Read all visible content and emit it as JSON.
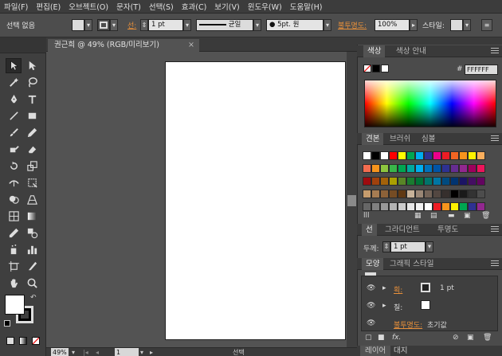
{
  "menu": [
    "파일(F)",
    "편집(E)",
    "오브젝트(O)",
    "문자(T)",
    "선택(S)",
    "효과(C)",
    "보기(V)",
    "윈도우(W)",
    "도움말(H)"
  ],
  "control_bar": {
    "selection_label": "선택 없음",
    "stroke_label": "선:",
    "stroke_weight": "1 pt",
    "stroke_profile": "균일",
    "brush_label": "● 5pt. 원",
    "opacity_label": "불투명도:",
    "opacity_value": "100%",
    "style_label": "스타일:"
  },
  "document_tab": {
    "title": "권근희 @ 49% (RGB/미리보기)",
    "close": "×"
  },
  "status_bar": {
    "zoom": "49%",
    "artboard": "1",
    "tool": "선택"
  },
  "color_panel": {
    "tabs": [
      "색상",
      "색상 안내"
    ],
    "hex_prefix": "#",
    "hex_value": "FFFFFF"
  },
  "swatches_panel": {
    "tabs": [
      "견본",
      "브러쉬",
      "심볼"
    ],
    "rows": [
      [
        "#ffffff",
        "#000000",
        "#ffffff",
        "#ff0000",
        "#ffff00",
        "#00a650",
        "#00aeef",
        "#2e3192",
        "#ec008c",
        "#ed1c24",
        "#f26522",
        "#f7941d",
        "#fff200",
        "#fbaf5d"
      ],
      [
        "#f26c4f",
        "#f7941d",
        "#8dc63f",
        "#39b54a",
        "#00a651",
        "#00a99d",
        "#00aeef",
        "#0072bc",
        "#0054a6",
        "#2e3192",
        "#662d91",
        "#92278f",
        "#9e005d",
        "#ed145b"
      ],
      [
        "#9e0b0f",
        "#a0410d",
        "#a3620a",
        "#aba000",
        "#598527",
        "#1a7b30",
        "#007236",
        "#00746b",
        "#0076a3",
        "#004b80",
        "#003471",
        "#1b1464",
        "#440e62",
        "#630460"
      ],
      [
        "#c69c6d",
        "#a67c52",
        "#8c6239",
        "#754c24",
        "#603913",
        "#c7b299",
        "#998675",
        "#736357",
        "#534741",
        "#362f2d",
        "#000000",
        "#1a1a1a",
        "#333333",
        "#4d4d4d"
      ],
      [
        "#666666",
        "#808080",
        "#999999",
        "#b3b3b3",
        "#cccccc",
        "#e6e6e6",
        "#f2f2f2",
        "#ffffff",
        "#ed1c24",
        "#f7941d",
        "#fff200",
        "#00a651",
        "#2e3192",
        "#92278f"
      ]
    ]
  },
  "stroke_panel": {
    "tabs": [
      "선",
      "그라디언트",
      "투명도"
    ],
    "weight_label": "두께:",
    "weight_value": "1 pt"
  },
  "appearance_panel": {
    "tabs": [
      "모양",
      "그래픽 스타일"
    ],
    "stroke_label": "획:",
    "stroke_value": "1 pt",
    "fill_label": "칠:",
    "opacity_label": "불투명도:",
    "opacity_value": "초기값",
    "fx_label": "fx."
  },
  "bottom_tabs": [
    "레이어",
    "대지"
  ],
  "colors": {
    "accent_orange": "#e8903a",
    "ui_dark": "#3a3a3a",
    "ui_mid": "#535353"
  }
}
